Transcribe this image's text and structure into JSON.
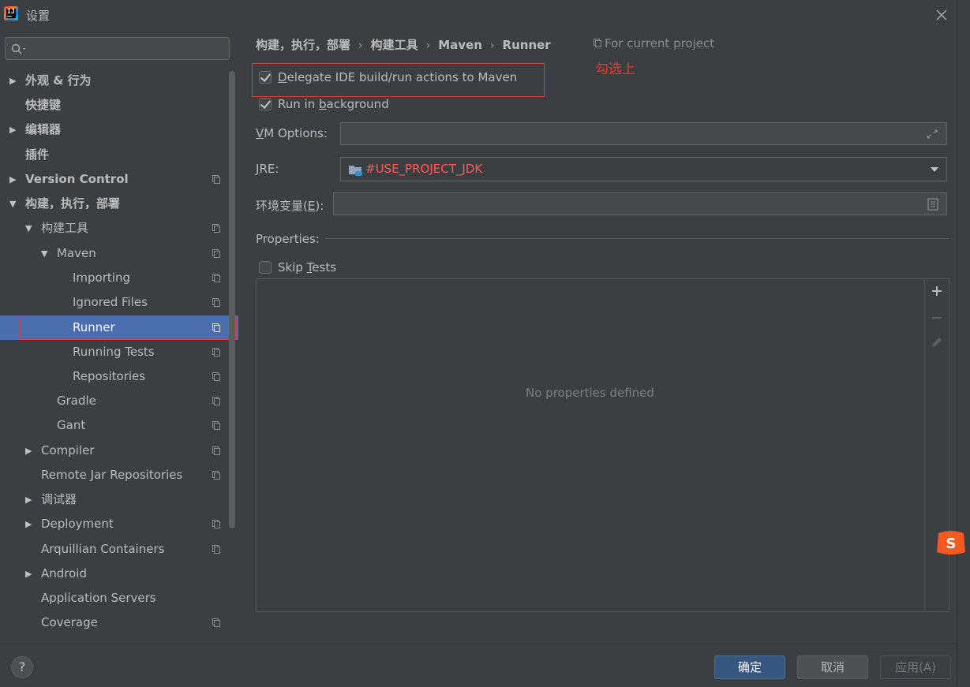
{
  "window": {
    "title": "设置",
    "logo_text": "IJ"
  },
  "search": {
    "placeholder": ""
  },
  "sidebar": {
    "items": [
      {
        "label": "外观 & 行为"
      },
      {
        "label": "快捷键"
      },
      {
        "label": "编辑器"
      },
      {
        "label": "插件"
      },
      {
        "label": "Version Control"
      },
      {
        "label": "构建，执行，部署"
      },
      {
        "label": "构建工具"
      },
      {
        "label": "Maven"
      },
      {
        "label": "Importing"
      },
      {
        "label": "Ignored Files"
      },
      {
        "label": "Runner"
      },
      {
        "label": "Running Tests"
      },
      {
        "label": "Repositories"
      },
      {
        "label": "Gradle"
      },
      {
        "label": "Gant"
      },
      {
        "label": "Compiler"
      },
      {
        "label": "Remote Jar Repositories"
      },
      {
        "label": "调试器"
      },
      {
        "label": "Deployment"
      },
      {
        "label": "Arquillian Containers"
      },
      {
        "label": "Android"
      },
      {
        "label": "Application Servers"
      },
      {
        "label": "Coverage"
      }
    ]
  },
  "breadcrumb": {
    "items": [
      "构建，执行，部署",
      "构建工具",
      "Maven",
      "Runner"
    ]
  },
  "scope_label": "For current project",
  "annotation_note": "勾选上",
  "options": {
    "delegate": {
      "pre": "",
      "u": "D",
      "post": "elegate IDE build/run actions to Maven",
      "checked": true
    },
    "background": {
      "pre": "Run in ",
      "u": "b",
      "post": "ackground",
      "checked": true
    },
    "skip_tests": {
      "pre": "Skip ",
      "u": "T",
      "post": "ests",
      "checked": false
    }
  },
  "fields": {
    "vm_options": {
      "u": "V",
      "post": "M Options:",
      "value": ""
    },
    "jre": {
      "u": "J",
      "post": "RE:",
      "value": "#USE_PROJECT_JDK"
    },
    "env": {
      "pre": "环境变量(",
      "u": "E",
      "post": "):",
      "value": ""
    }
  },
  "properties": {
    "heading": "Properties:",
    "empty_text": "No properties defined"
  },
  "buttons": {
    "ok": "确定",
    "cancel": "取消",
    "apply": "应用(A)",
    "help": "?"
  },
  "colors": {
    "selection": "#4b6eaf",
    "annotation": "#e53935",
    "jre_value": "#ff5a5a",
    "ok_button": "#365880"
  }
}
